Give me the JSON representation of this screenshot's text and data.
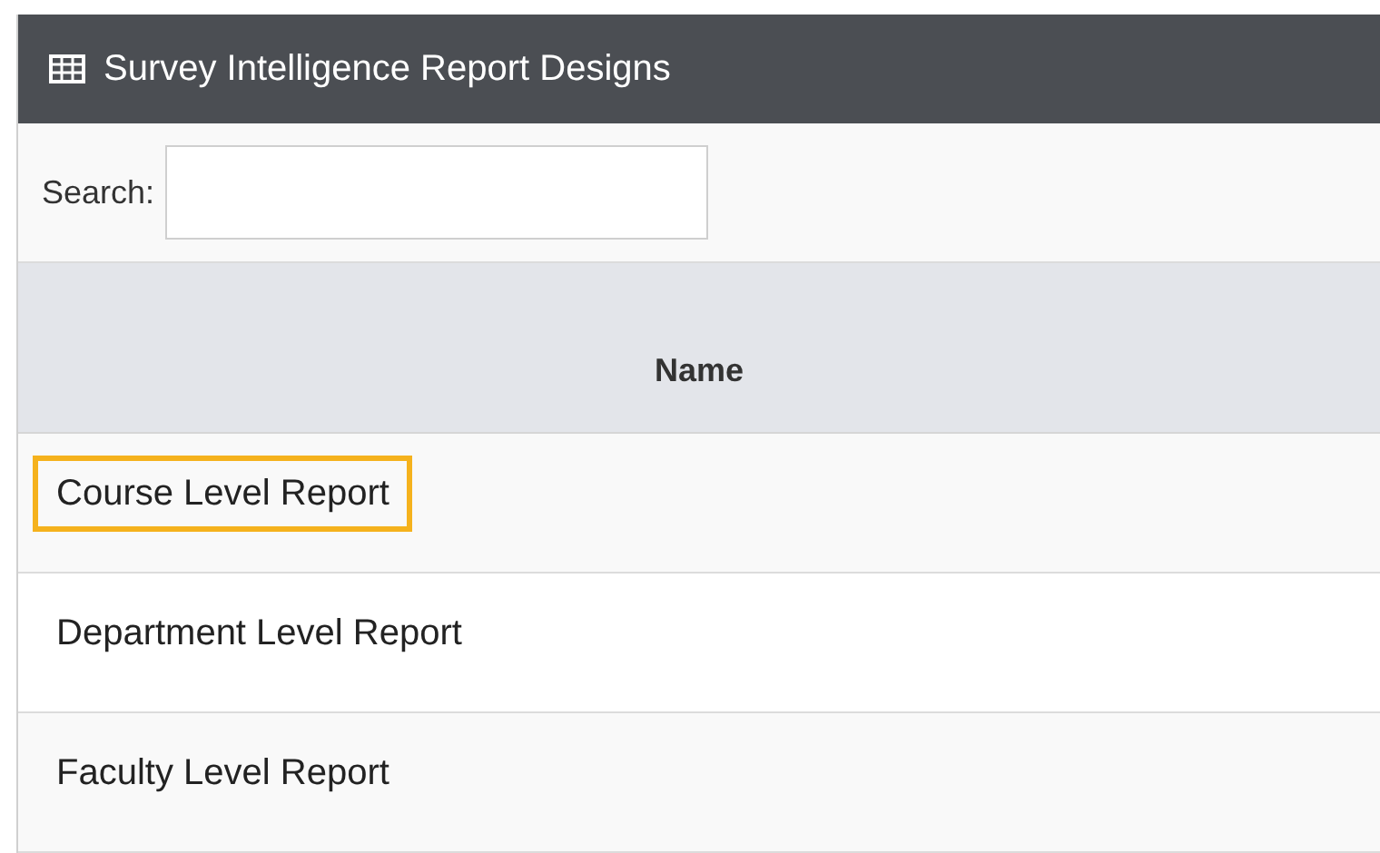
{
  "panel": {
    "title": "Survey Intelligence Report Designs"
  },
  "search": {
    "label": "Search:"
  },
  "table": {
    "columns": [
      "Name"
    ],
    "rows": [
      {
        "name": "Course Level Report",
        "highlighted": true
      },
      {
        "name": "Department Level Report",
        "highlighted": false
      },
      {
        "name": "Faculty Level Report",
        "highlighted": false
      }
    ]
  }
}
